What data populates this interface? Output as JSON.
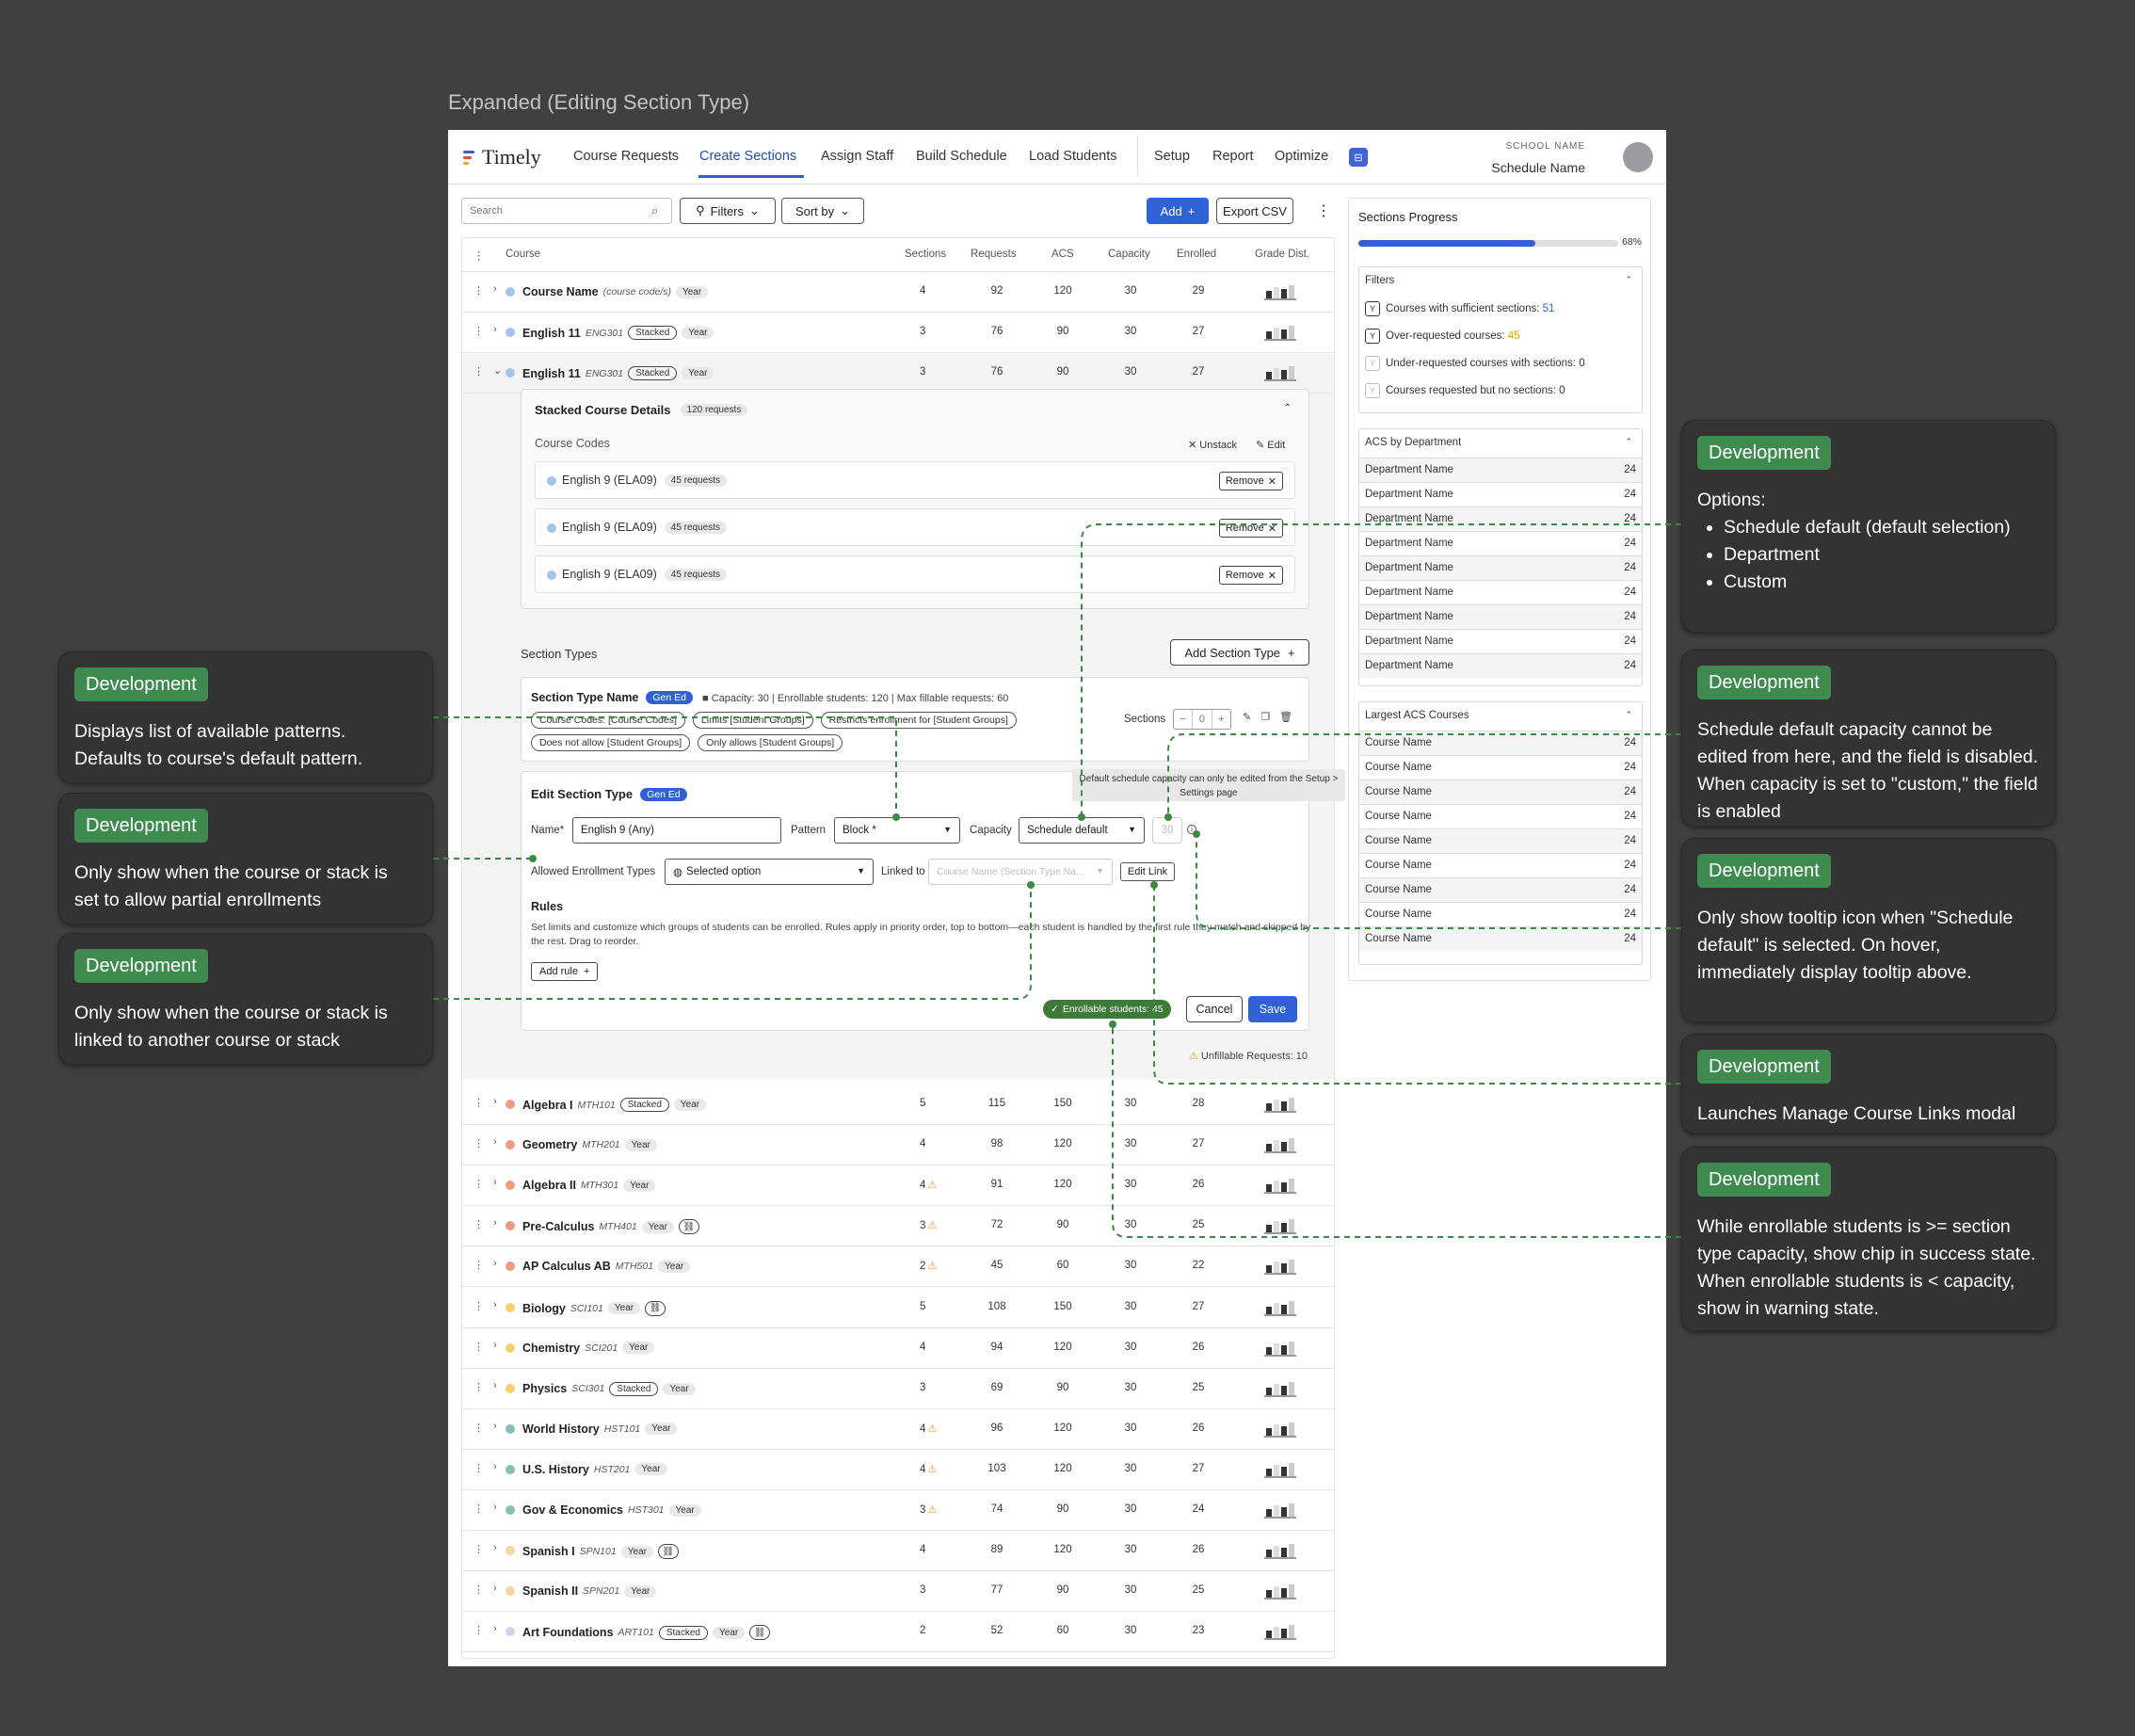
{
  "frame_title": "Expanded (Editing Section Type)",
  "nav": {
    "logo": "Timely",
    "items": [
      "Course Requests",
      "Create Sections",
      "Assign Staff",
      "Build Schedule",
      "Load Students",
      "Setup",
      "Report",
      "Optimize"
    ],
    "school_label": "SCHOOL NAME",
    "school_name": "Schedule Name",
    "logo_colors": [
      "#2f62d6",
      "#e5483c",
      "#f0a21e"
    ]
  },
  "toolbar": {
    "search_placeholder": "Search",
    "filters": "Filters",
    "sort": "Sort by",
    "add": "Add",
    "export": "Export CSV"
  },
  "table": {
    "headers": [
      "Course",
      "Sections",
      "Requests",
      "ACS",
      "Capacity",
      "Enrolled",
      "Grade Dist."
    ]
  },
  "rows_top": [
    {
      "name": "Course Name",
      "code": "(course code/s)",
      "tags": [
        "Year"
      ],
      "sections": "4",
      "requests": "92",
      "acs": "120",
      "capacity": "30",
      "enrolled": "29",
      "color": "#a6c3ec",
      "chev": "›"
    },
    {
      "name": "English 11",
      "code": "ENG301",
      "tags": [
        "Stacked",
        "Year"
      ],
      "sections": "3",
      "requests": "76",
      "acs": "90",
      "capacity": "30",
      "enrolled": "27",
      "color": "#a6c3ec",
      "chev": "›"
    },
    {
      "name": "English 11",
      "code": "ENG301",
      "tags": [
        "Stacked",
        "Year"
      ],
      "sections": "3",
      "requests": "76",
      "acs": "90",
      "capacity": "30",
      "enrolled": "27",
      "color": "#a6c3ec",
      "chev": "⌄"
    }
  ],
  "stack": {
    "title": "Stacked Course Details",
    "count": "120 requests",
    "codes_label": "Course Codes",
    "unstack": "Unstack",
    "edit": "Edit",
    "remove": "Remove",
    "codes": [
      {
        "name": "English 9 (ELA09)",
        "requests": "45 requests"
      },
      {
        "name": "English 9 (ELA09)",
        "requests": "45 requests"
      },
      {
        "name": "English 9 (ELA09)",
        "requests": "45 requests"
      }
    ]
  },
  "section_types": {
    "label": "Section Types",
    "add": "Add Section Type",
    "name": "Section Type Name",
    "chip": "Gen Ed",
    "meta": "Capacity: 30  |  Enrollable students: 120  |  Max fillable requests: 60",
    "pills1": [
      "Course Codes: [Course Codes]",
      "Limits [Student Groups]",
      "Restricts enrollment for [Student Groups]"
    ],
    "pills2": [
      "Does not allow [Student Groups]",
      "Only allows [Student Groups]"
    ],
    "sections_label": "Sections",
    "stepper_value": "0"
  },
  "edit": {
    "title": "Edit Section Type",
    "chip": "Gen Ed",
    "name_label": "Name*",
    "name_value": "English 9 (Any)",
    "pattern_label": "Pattern",
    "pattern_value": "Block *",
    "capacity_label": "Capacity",
    "capacity_value": "Schedule default",
    "capacity_num": "30",
    "allowed_label": "Allowed Enrollment Types",
    "allowed_value": "Selected option",
    "linked_label": "Linked to",
    "linked_placeholder": "Course Name (Section Type Na...",
    "edit_link": "Edit Link",
    "rules_title": "Rules",
    "rules_desc": "Set limits and customize which groups of students can be enrolled. Rules apply in priority order, top to bottom—each student is handled by the first rule they match and skipped by the rest. Drag to reorder.",
    "add_rule": "Add rule",
    "enrollable": "Enrollable students: 45",
    "cancel": "Cancel",
    "save": "Save",
    "tooltip": "Default schedule capacity can only be edited from the Setup > Settings page",
    "unfillable": "Unfillable Requests: 10"
  },
  "rows_bottom": [
    {
      "name": "Algebra I",
      "code": "MTH101",
      "tags": [
        "Stacked",
        "Year"
      ],
      "sections": "5",
      "warn": false,
      "requests": "115",
      "acs": "150",
      "capacity": "30",
      "enrolled": "28",
      "color": "#ee9b82"
    },
    {
      "name": "Geometry",
      "code": "MTH201",
      "tags": [
        "Year"
      ],
      "sections": "4",
      "warn": false,
      "requests": "98",
      "acs": "120",
      "capacity": "30",
      "enrolled": "27",
      "color": "#ee9b82"
    },
    {
      "name": "Algebra II",
      "code": "MTH301",
      "tags": [
        "Year"
      ],
      "sections": "4",
      "warn": true,
      "requests": "91",
      "acs": "120",
      "capacity": "30",
      "enrolled": "26",
      "color": "#ee9b82"
    },
    {
      "name": "Pre-Calculus",
      "code": "MTH401",
      "tags": [
        "Year"
      ],
      "link": true,
      "sections": "3",
      "warn": true,
      "requests": "72",
      "acs": "90",
      "capacity": "30",
      "enrolled": "25",
      "color": "#ee9b82"
    },
    {
      "name": "AP Calculus AB",
      "code": "MTH501",
      "tags": [
        "Year"
      ],
      "sections": "2",
      "warn": true,
      "requests": "45",
      "acs": "60",
      "capacity": "30",
      "enrolled": "22",
      "color": "#ee9b82"
    },
    {
      "name": "Biology",
      "code": "SCI101",
      "tags": [
        "Year"
      ],
      "link": true,
      "sections": "5",
      "warn": false,
      "requests": "108",
      "acs": "150",
      "capacity": "30",
      "enrolled": "27",
      "color": "#f5cf6b"
    },
    {
      "name": "Chemistry",
      "code": "SCI201",
      "tags": [
        "Year"
      ],
      "sections": "4",
      "warn": false,
      "requests": "94",
      "acs": "120",
      "capacity": "30",
      "enrolled": "26",
      "color": "#f5cf6b"
    },
    {
      "name": "Physics",
      "code": "SCI301",
      "tags": [
        "Stacked",
        "Year"
      ],
      "sections": "3",
      "warn": false,
      "requests": "69",
      "acs": "90",
      "capacity": "30",
      "enrolled": "25",
      "color": "#f5cf6b"
    },
    {
      "name": "World History",
      "code": "HST101",
      "tags": [
        "Year"
      ],
      "sections": "4",
      "warn": true,
      "requests": "96",
      "acs": "120",
      "capacity": "30",
      "enrolled": "26",
      "color": "#86c0b8"
    },
    {
      "name": "U.S. History",
      "code": "HST201",
      "tags": [
        "Year"
      ],
      "sections": "4",
      "warn": true,
      "requests": "103",
      "acs": "120",
      "capacity": "30",
      "enrolled": "27",
      "color": "#86c0b8"
    },
    {
      "name": "Gov & Economics",
      "code": "HST301",
      "tags": [
        "Year"
      ],
      "sections": "3",
      "warn": true,
      "requests": "74",
      "acs": "90",
      "capacity": "30",
      "enrolled": "24",
      "color": "#86c0b8"
    },
    {
      "name": "Spanish I",
      "code": "SPN101",
      "tags": [
        "Year"
      ],
      "link": true,
      "sections": "4",
      "warn": false,
      "requests": "89",
      "acs": "120",
      "capacity": "30",
      "enrolled": "26",
      "color": "#f4d6a4"
    },
    {
      "name": "Spanish II",
      "code": "SPN201",
      "tags": [
        "Year"
      ],
      "sections": "3",
      "warn": false,
      "requests": "77",
      "acs": "90",
      "capacity": "30",
      "enrolled": "25",
      "color": "#f4d6a4"
    },
    {
      "name": "Art Foundations",
      "code": "ART101",
      "tags": [
        "Stacked",
        "Year"
      ],
      "link": true,
      "sections": "2",
      "warn": false,
      "requests": "52",
      "acs": "60",
      "capacity": "30",
      "enrolled": "23",
      "color": "#d6cff0"
    }
  ],
  "sidebar": {
    "title": "Sections Progress",
    "progress": 0.68,
    "progress_label": "68%",
    "filters_title": "Filters",
    "filters": [
      {
        "label": "Courses with sufficient sections: ",
        "value": "51",
        "color": "#2f62d6",
        "dim": false
      },
      {
        "label": "Over-requested courses: ",
        "value": "45",
        "color": "#e89a1a",
        "dim": false
      },
      {
        "label": "Under-requested courses with sections: ",
        "value": "0",
        "color": "#333",
        "dim": true
      },
      {
        "label": "Courses requested but no sections: ",
        "value": "0",
        "color": "#333",
        "dim": true
      }
    ],
    "acs_title": "ACS by Department",
    "acs": [
      {
        "name": "Department Name",
        "value": "24"
      },
      {
        "name": "Department Name",
        "value": "24"
      },
      {
        "name": "Department Name",
        "value": "24"
      },
      {
        "name": "Department Name",
        "value": "24"
      },
      {
        "name": "Department Name",
        "value": "24"
      },
      {
        "name": "Department Name",
        "value": "24"
      },
      {
        "name": "Department Name",
        "value": "24"
      },
      {
        "name": "Department Name",
        "value": "24"
      },
      {
        "name": "Department Name",
        "value": "24"
      }
    ],
    "largest_title": "Largest ACS Courses",
    "largest": [
      {
        "name": "Course Name",
        "value": "24"
      },
      {
        "name": "Course Name",
        "value": "24"
      },
      {
        "name": "Course Name",
        "value": "24"
      },
      {
        "name": "Course Name",
        "value": "24"
      },
      {
        "name": "Course Name",
        "value": "24"
      },
      {
        "name": "Course Name",
        "value": "24"
      },
      {
        "name": "Course Name",
        "value": "24"
      },
      {
        "name": "Course Name",
        "value": "24"
      },
      {
        "name": "Course Name",
        "value": "24"
      }
    ]
  },
  "annotations": {
    "tag": "Development",
    "left": [
      {
        "text": "Displays list of available patterns. Defaults to course's default pattern."
      },
      {
        "text": "Only show when the course or stack is set to allow partial enrollments"
      },
      {
        "text": "Only show when the course or stack is linked to another course or stack"
      }
    ],
    "right": [
      {
        "intro": "Options:",
        "items": [
          "Schedule default (default selection)",
          "Department",
          "Custom"
        ]
      },
      {
        "text": "Schedule default capacity cannot be edited from here, and the field is disabled. When capacity is set to \"custom,\" the field is enabled"
      },
      {
        "text": "Only show tooltip icon when \"Schedule default\" is selected. On hover, immediately display tooltip above."
      },
      {
        "text": "Launches Manage Course Links modal"
      },
      {
        "text": "While enrollable students is >= section type capacity, show chip in success state. When enrollable students is < capacity, show in warning state."
      }
    ]
  },
  "colors": {
    "primary": "#2f62d6",
    "success": "#3d7b3a",
    "tag": "#3f8a4f",
    "warn": "#e89a1a"
  }
}
